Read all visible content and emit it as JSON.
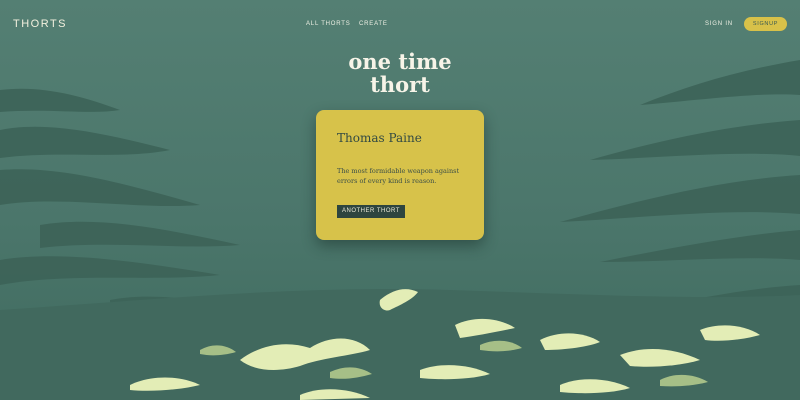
{
  "nav": {
    "logo": "THORTS",
    "links": [
      "ALL THORTS",
      "CREATE"
    ],
    "sign_in": "SIGN IN",
    "sign_up": "SIGNUP"
  },
  "hero": {
    "line1": "one time",
    "line2": "thort"
  },
  "card": {
    "author": "Thomas Paine",
    "quote": "The most formidable weapon against errors of every kind is reason.",
    "button": "ANOTHER THORT"
  },
  "colors": {
    "background": "#4e7a70",
    "card": "#d7c24a",
    "button_dark": "#2e453f",
    "accent_yellow": "#d8c149",
    "cloud_light": "#e3edb6"
  }
}
